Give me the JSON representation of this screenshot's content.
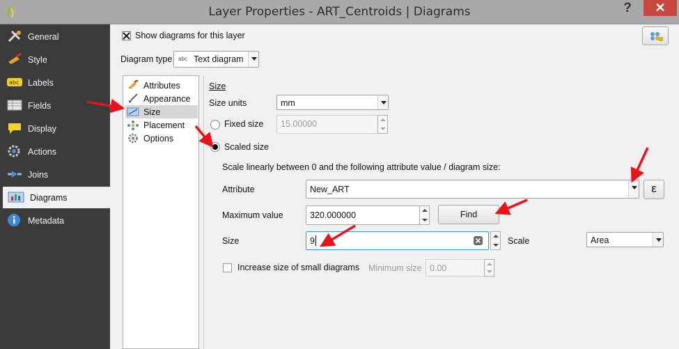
{
  "window": {
    "title": "Layer Properties - ART_Centroids | Diagrams",
    "help_label": "?",
    "close_label": "✕"
  },
  "sidebar": {
    "items": [
      {
        "label": "General",
        "icon": "general-icon"
      },
      {
        "label": "Style",
        "icon": "style-icon"
      },
      {
        "label": "Labels",
        "icon": "labels-icon"
      },
      {
        "label": "Fields",
        "icon": "fields-icon"
      },
      {
        "label": "Display",
        "icon": "display-icon"
      },
      {
        "label": "Actions",
        "icon": "actions-icon"
      },
      {
        "label": "Joins",
        "icon": "joins-icon"
      },
      {
        "label": "Diagrams",
        "icon": "diagrams-icon",
        "active": true
      },
      {
        "label": "Metadata",
        "icon": "metadata-icon"
      }
    ]
  },
  "header": {
    "show_diagrams_label": "Show diagrams for this layer",
    "show_diagrams_checked": true,
    "diagram_type_label": "Diagram type",
    "diagram_type_prefix": "abc",
    "diagram_type_value": "Text diagram"
  },
  "sections": {
    "items": [
      {
        "label": "Attributes"
      },
      {
        "label": "Appearance"
      },
      {
        "label": "Size",
        "selected": true
      },
      {
        "label": "Placement"
      },
      {
        "label": "Options"
      }
    ]
  },
  "size": {
    "heading": "Size",
    "units_label": "Size units",
    "units_value": "mm",
    "fixed_label": "Fixed size",
    "fixed_value": "15.00000",
    "scaled_label": "Scaled size",
    "scale_desc": "Scale linearly between 0 and the following attribute value / diagram size:",
    "attribute_label": "Attribute",
    "attribute_value": "New_ART",
    "expression_symbol": "ε",
    "max_label": "Maximum value",
    "max_value": "320.000000",
    "find_label": "Find",
    "size_label": "Size",
    "size_value": "9",
    "scale_label": "Scale",
    "scale_value": "Area",
    "increase_label": "Increase size of small diagrams",
    "min_size_label": "Minimum size",
    "min_size_value": "0.00"
  },
  "colors": {
    "annotation_arrow": "#e8141c",
    "sidebar_bg": "#3b3b3b",
    "close_button": "#c7463d"
  }
}
